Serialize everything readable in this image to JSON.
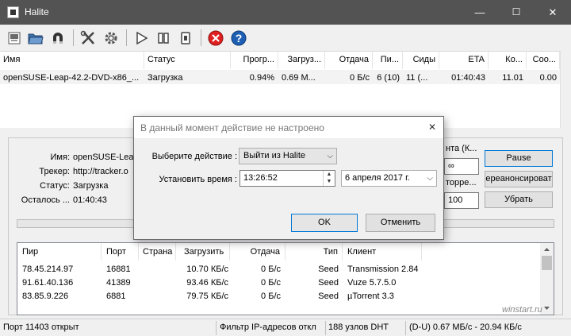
{
  "window": {
    "title": "Halite",
    "min": "—",
    "max": "☐",
    "close": "✕"
  },
  "toolbar": {
    "icons": [
      "add-torrent-icon",
      "open-folder-icon",
      "magnet-icon",
      "settings-tools-icon",
      "gear-icon",
      "play-icon",
      "pause-icon",
      "stop-icon",
      "remove-icon",
      "help-icon"
    ]
  },
  "list": {
    "headers": [
      "Имя",
      "Статус",
      "Прогр...",
      "Загруз...",
      "Отдача",
      "Пи...",
      "Сиды",
      "ETA",
      "Ко...",
      "Соо..."
    ],
    "rows": [
      [
        "openSUSE-Leap-42.2-DVD-x86_...",
        "Загрузка",
        "0.94%",
        "0.69 M...",
        "0 Б/с",
        "6 (10)",
        "11 (...",
        "01:40:43",
        "11.01",
        "0.00"
      ]
    ]
  },
  "details": {
    "name_label": "Имя:",
    "name_value": "openSUSE-Leap",
    "tracker_label": "Трекер:",
    "tracker_value": "http://tracker.o",
    "status_label": "Статус:",
    "status_value": "Загрузка",
    "remaining_label": "Осталось ...",
    "remaining_value": "01:40:43",
    "right_label1": "нта (К...",
    "right_field1": "∞",
    "right_label2": "торре...",
    "right_field2": "100",
    "pause_button": "Pause",
    "reannounce_button": "ереанонсироват",
    "remove_button": "Убрать"
  },
  "peers": {
    "headers": [
      "Пир",
      "Порт",
      "Страна",
      "Загрузить",
      "Отдача",
      "Тип",
      "Клиент"
    ],
    "rows": [
      [
        "78.45.214.97",
        "16881",
        "",
        "10.70 КБ/с",
        "0 Б/с",
        "Seed",
        "Transmission 2.84"
      ],
      [
        "91.61.40.136",
        "41389",
        "",
        "93.46 КБ/с",
        "0 Б/с",
        "Seed",
        "Vuze 5.7.5.0"
      ],
      [
        "83.85.9.226",
        "6881",
        "",
        "79.75 КБ/с",
        "0 Б/с",
        "Seed",
        "µTorrent 3.3"
      ]
    ]
  },
  "statusbar": {
    "port": "Порт 11403 открыт",
    "ipfilter": "Фильтр IP-адресов откл",
    "dht": "188 узлов DHT",
    "speed": "(D-U) 0.67 МБ/с - 20.94 КБ/с"
  },
  "dialog": {
    "title": "В данный момент действие не настроено",
    "action_label": "Выберите действие :",
    "action_value": "Выйти из Halite",
    "time_label": "Установить время :",
    "time_value": "13:26:52",
    "date_value": "6  апреля  2017 г.",
    "ok_button": "OK",
    "cancel_button": "Отменить"
  },
  "watermark": "winstart.ru",
  "colors": {
    "titlebar": "#535353",
    "accent": "#0078d7",
    "stop_red": "#e02020",
    "help_blue": "#1e5fb4"
  }
}
